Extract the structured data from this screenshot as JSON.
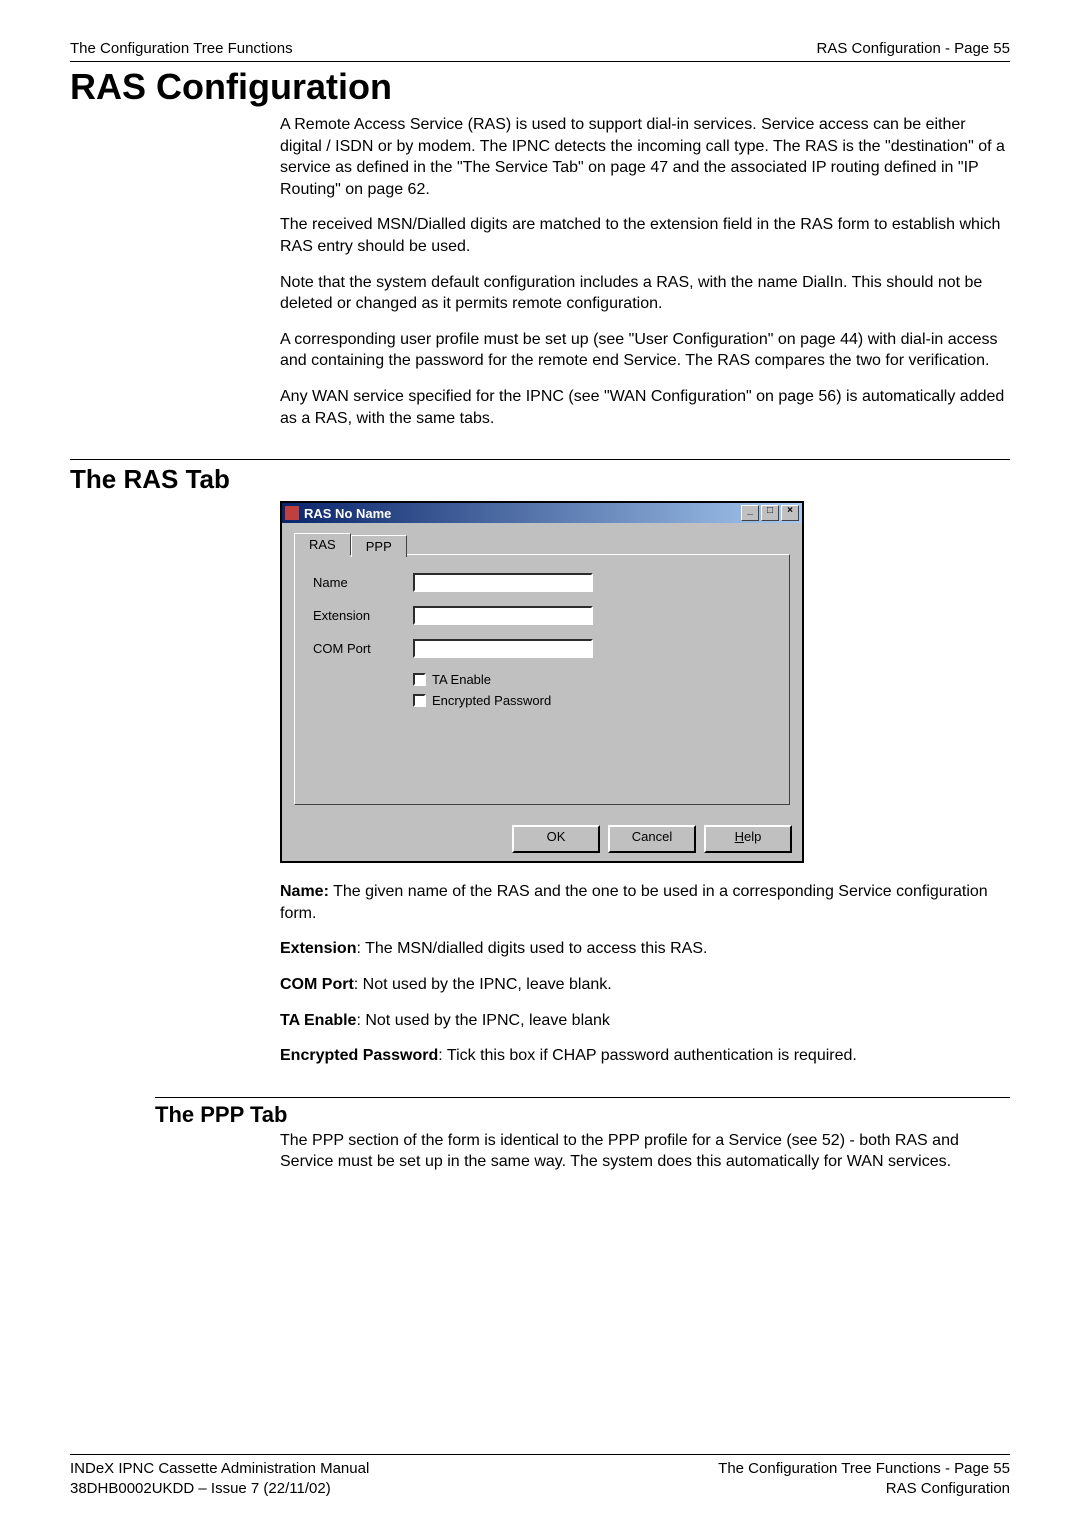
{
  "header": {
    "left": "The Configuration Tree Functions",
    "right": "RAS Configuration - Page 55"
  },
  "title": "RAS Configuration",
  "intro": {
    "p1": "A Remote Access Service (RAS) is used to support dial-in services. Service access can be either digital / ISDN or by modem. The IPNC detects the incoming call type. The RAS is the \"destination\" of a service as defined in the \"The Service Tab\" on page 47 and the associated IP routing defined in \"IP Routing\" on page 62.",
    "p2": "The received MSN/Dialled digits are matched to the extension field in the RAS form to establish which RAS entry should be used.",
    "p3": "Note that the system default configuration includes a RAS, with the name DialIn. This should not be deleted or changed as it permits remote configuration.",
    "p4": "A corresponding user profile must be set up (see \"User Configuration\" on page 44) with dial-in access and containing the password for the remote end Service. The RAS compares the two for verification.",
    "p5": "Any WAN service specified for the IPNC (see \"WAN Configuration\" on page 56) is automatically added as a RAS, with the same tabs."
  },
  "ras_tab": {
    "heading": "The RAS Tab",
    "dialog": {
      "title": "RAS No Name",
      "tabs": {
        "ras": "RAS",
        "ppp": "PPP"
      },
      "labels": {
        "name": "Name",
        "extension": "Extension",
        "comport": "COM Port",
        "ta_enable": "TA Enable",
        "enc_pass": "Encrypted Password"
      },
      "fields": {
        "name": "",
        "extension": "",
        "comport": ""
      },
      "buttons": {
        "ok": "OK",
        "cancel": "Cancel",
        "help_letter": "H",
        "help_rest": "elp"
      },
      "win_controls": {
        "min": "_",
        "max": "□",
        "close": "×"
      }
    },
    "desc": {
      "name_b": "Name:",
      "name_t": " The given name of the RAS and the one to be used in a corresponding Service configuration form.",
      "ext_b": "Extension",
      "ext_t": ": The MSN/dialled digits used to access this RAS.",
      "com_b": "COM Port",
      "com_t": ": Not used by the IPNC, leave blank.",
      "ta_b": "TA Enable",
      "ta_t": ": Not used by the IPNC, leave blank",
      "enc_b": "Encrypted Password",
      "enc_t": ": Tick this box if CHAP password authentication is required."
    }
  },
  "ppp_tab": {
    "heading": "The PPP Tab",
    "p1": "The PPP section of the form is identical to the PPP profile for a Service (see 52) - both RAS and Service must be set up in the same way. The system does this automatically for WAN services."
  },
  "footer": {
    "left": "INDeX IPNC Cassette Administration Manual\n38DHB0002UKDD – Issue 7 (22/11/02)",
    "right": "The Configuration Tree Functions - Page 55\nRAS Configuration"
  }
}
